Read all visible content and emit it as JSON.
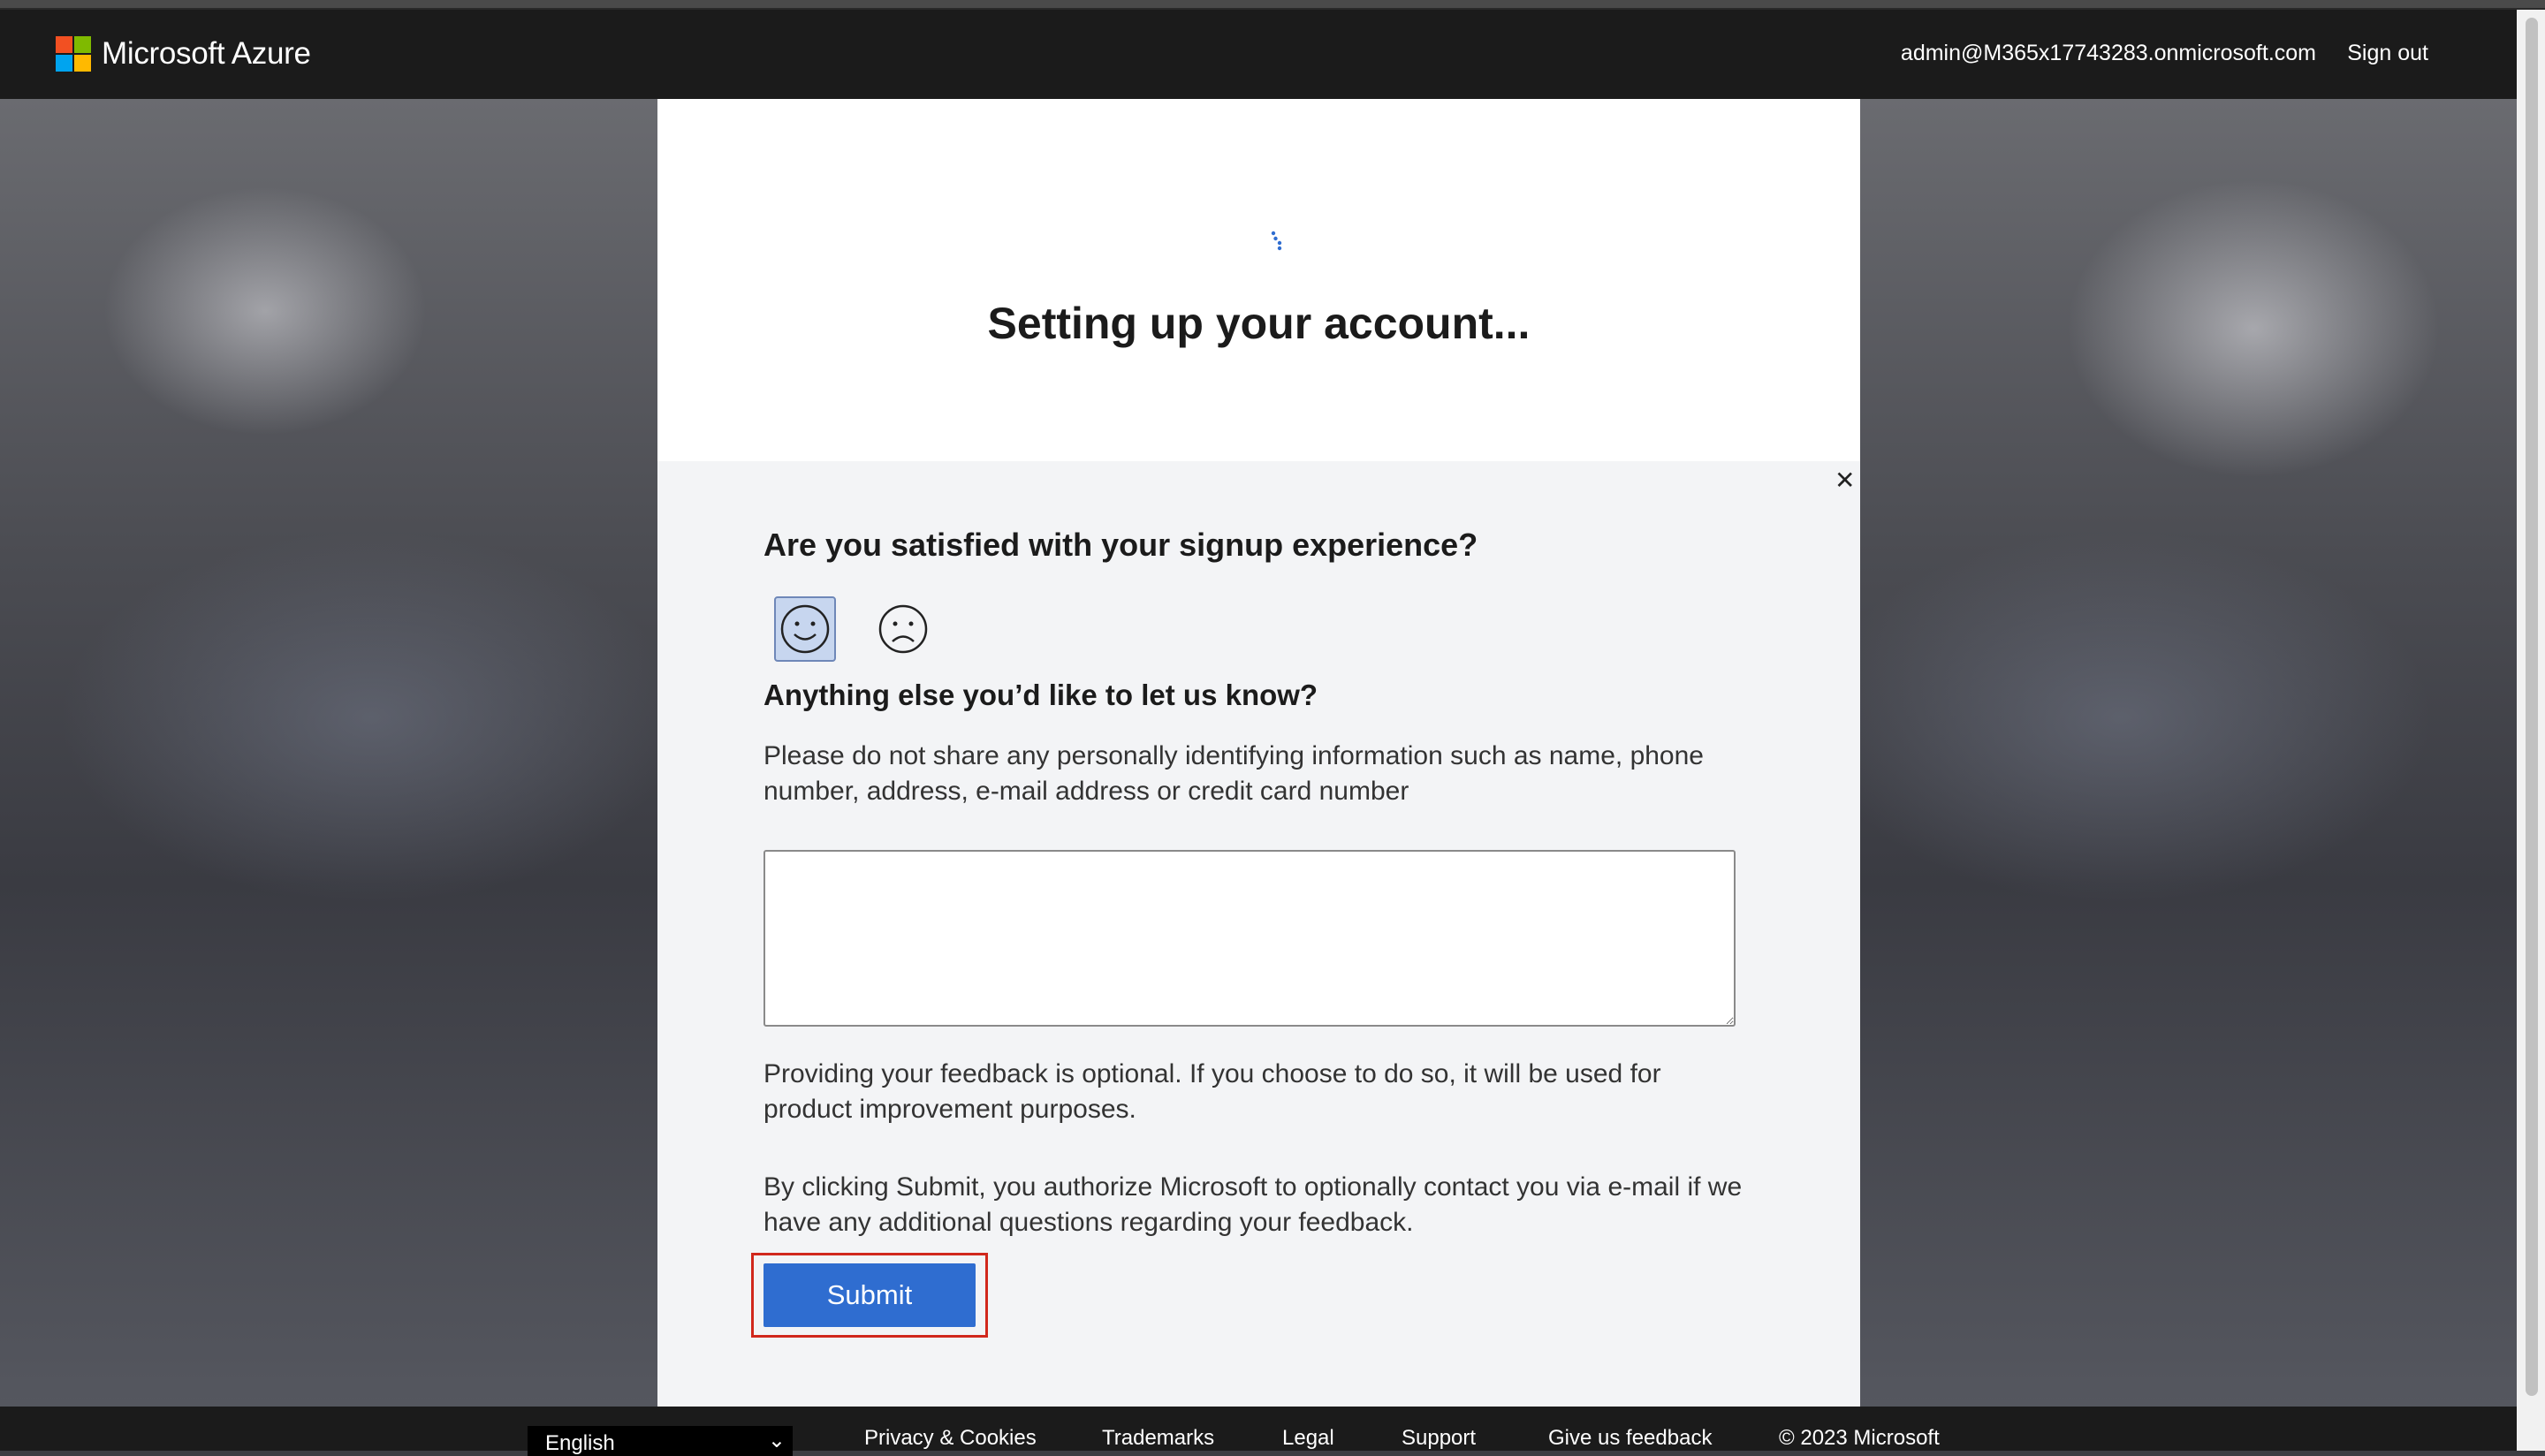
{
  "header": {
    "brand": "Microsoft Azure",
    "account": "admin@M365x17743283.onmicrosoft.com",
    "sign_out": "Sign out"
  },
  "main": {
    "title": "Setting up your account..."
  },
  "feedback": {
    "question": "Are you satisfied with your signup experience?",
    "selected_face": "happy",
    "followup": "Anything else you’d like to let us know?",
    "privacy_note": "Please do not share any personally identifying information such as name, phone number, address, e-mail address or credit card number",
    "textarea_value": "",
    "optional_note": "Providing your feedback is optional. If you choose to do so, it will be used for product improvement purposes.",
    "authorize_note": "By clicking Submit, you authorize Microsoft to optionally contact you via e-mail if we have any additional questions regarding your feedback.",
    "submit": "Submit"
  },
  "footer": {
    "language": "English",
    "links": [
      "Privacy & Cookies",
      "Trademarks",
      "Legal",
      "Support",
      "Give us feedback"
    ],
    "copyright": "© 2023 Microsoft"
  },
  "colors": {
    "header_bg": "#1b1b1b",
    "submit_bg": "#2f6dd0",
    "highlight_border": "#d1281c"
  }
}
